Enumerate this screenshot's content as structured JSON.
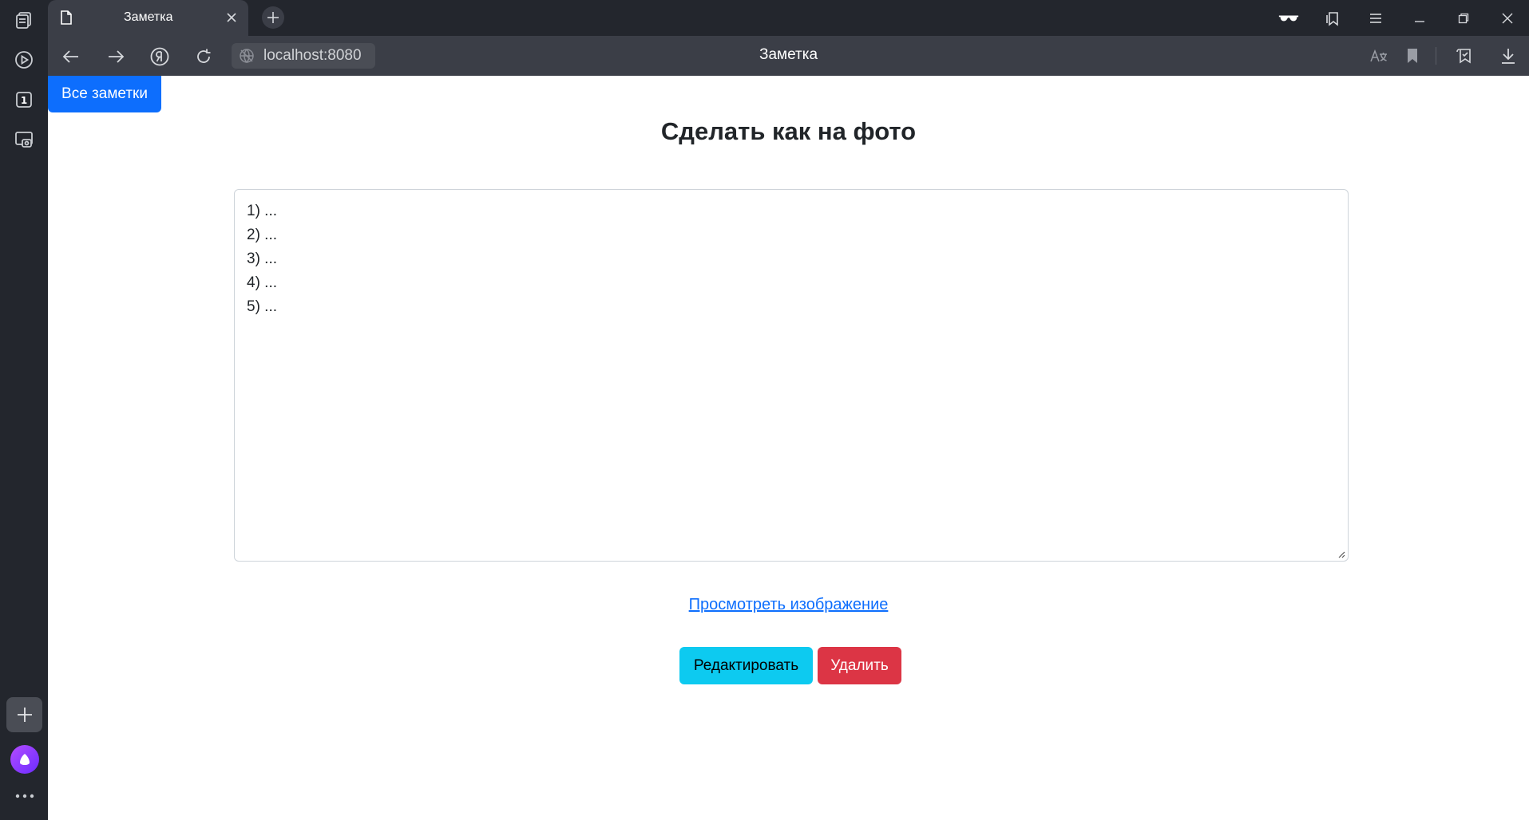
{
  "tab": {
    "title": "Заметка"
  },
  "address": {
    "url": "localhost:8080",
    "page_title": "Заметка"
  },
  "sidebar": {
    "tab_count": "1"
  },
  "page": {
    "all_notes_label": "Все заметки",
    "title": "Сделать как на фото",
    "body_lines": [
      "1) ...",
      "2) ...",
      "3) ...",
      "4) ...",
      "5) ..."
    ],
    "view_image_link": "Просмотреть изображение",
    "edit_label": "Редактировать",
    "delete_label": "Удалить"
  },
  "colors": {
    "primary": "#0d6efd",
    "info": "#0dcaf0",
    "danger": "#dc3545",
    "chrome_dark": "#23262d",
    "chrome_mid": "#3b3e47"
  },
  "icons": {
    "sidebar": [
      "tabs-icon",
      "play-icon",
      "tab-count-icon",
      "screenshot-icon",
      "add-icon",
      "alice-icon",
      "more-icon"
    ],
    "toolbar": [
      "back-icon",
      "forward-icon",
      "yandex-icon",
      "reload-icon",
      "site-info-icon",
      "translate-icon",
      "bookmark-icon",
      "collections-icon",
      "download-icon"
    ],
    "window": [
      "incognito-glasses-icon",
      "bookmarks-panel-icon",
      "menu-icon",
      "minimize-icon",
      "restore-icon",
      "close-window-icon"
    ]
  }
}
